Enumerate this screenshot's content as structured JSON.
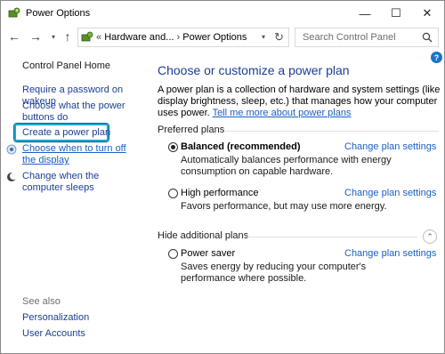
{
  "window": {
    "title": "Power Options",
    "icons": {
      "app": "power-options-icon",
      "minimize": "minimize-icon",
      "maximize": "maximize-icon",
      "close": "close-icon"
    },
    "minimize_glyph": "—",
    "maximize_glyph": "☐",
    "close_glyph": "✕"
  },
  "nav": {
    "back_glyph": "←",
    "forward_glyph": "→",
    "dropdown_glyph": "▾",
    "up_glyph": "↑",
    "address": {
      "prefix": "«",
      "crumb1": "Hardware and...",
      "sep": "›",
      "crumb2": "Power Options",
      "dropdown_glyph": "▾",
      "refresh_glyph": "↻"
    },
    "search_placeholder": "Search Control Panel"
  },
  "help_glyph": "?",
  "sidebar": {
    "home": "Control Panel Home",
    "require_password": "Require a password on wakeup",
    "choose_buttons": "Choose what the power buttons do",
    "create_plan": "Create a power plan",
    "turn_off_display": "Choose when to turn off the display",
    "sleeps": "Change when the computer sleeps",
    "see_also": "See also",
    "personalization": "Personalization",
    "user_accounts": "User Accounts"
  },
  "main": {
    "heading": "Choose or customize a power plan",
    "intro": "A power plan is a collection of hardware and system settings (like display brightness, sleep, etc.) that manages how your computer uses power.",
    "intro_link": "Tell me more about power plans",
    "preferred_label": "Preferred plans",
    "hidden_label": "Hide additional plans",
    "collapse_glyph": "⌃",
    "change_label": "Change plan settings",
    "plans": [
      {
        "name": "Balanced (recommended)",
        "desc": "Automatically balances performance with energy consumption on capable hardware.",
        "selected": true
      },
      {
        "name": "High performance",
        "desc": "Favors performance, but may use more energy.",
        "selected": false
      },
      {
        "name": "Power saver",
        "desc": "Saves energy by reducing your computer's performance where possible.",
        "selected": false
      }
    ]
  },
  "colors": {
    "link": "#1a3e93",
    "highlight": "#19a7d6"
  }
}
